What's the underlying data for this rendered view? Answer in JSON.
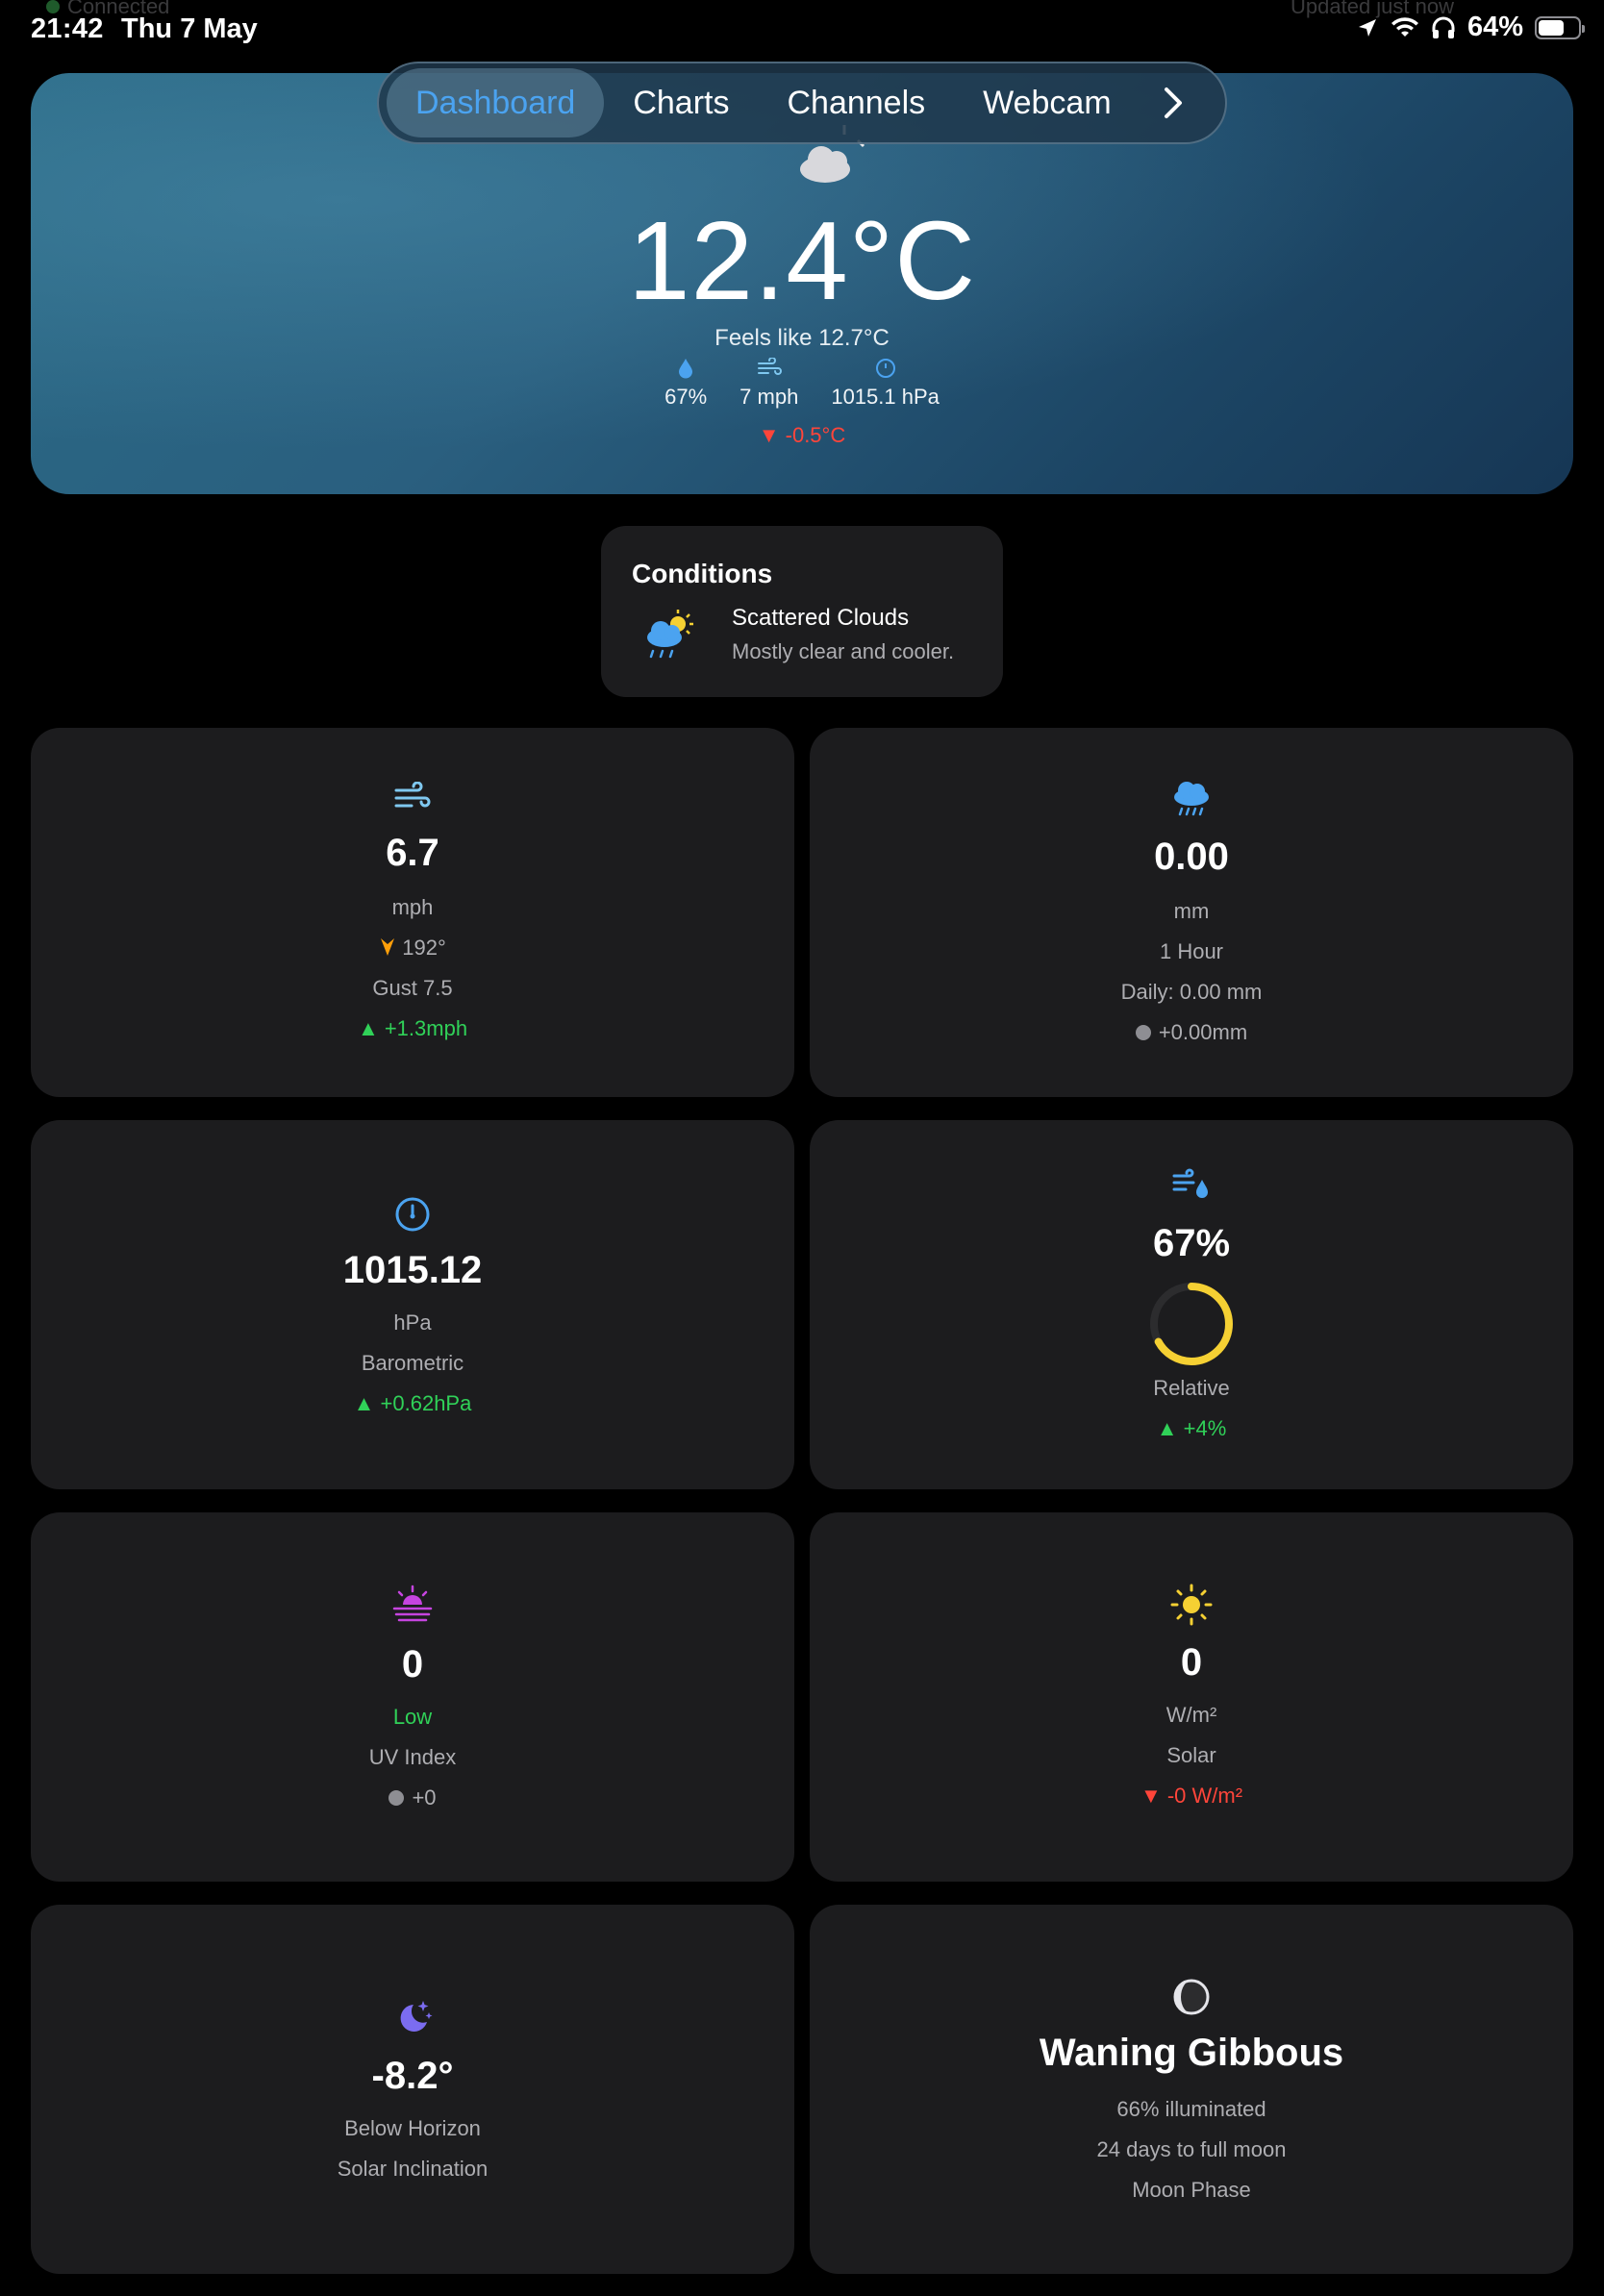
{
  "status_bar": {
    "time": "21:42",
    "date": "Thu 7 May",
    "connected": "Connected",
    "updated": "Updated just now",
    "battery": "64%",
    "battery_level": 0.64
  },
  "tabs": [
    {
      "label": "Dashboard",
      "active": true
    },
    {
      "label": "Charts",
      "active": false
    },
    {
      "label": "Channels",
      "active": false
    },
    {
      "label": "Webcam",
      "active": false
    }
  ],
  "hero": {
    "temperature": "12.4°C",
    "feels_like": "Feels like 12.7°C",
    "humidity": "67%",
    "wind": "7 mph",
    "pressure": "1015.1 hPa",
    "change": "▼ -0.5°C"
  },
  "conditions": {
    "title": "Conditions",
    "summary": "Scattered Clouds",
    "detail": "Mostly clear and cooler."
  },
  "cards": {
    "wind": {
      "value": "6.7",
      "unit": "mph",
      "direction": "192°",
      "gust": "Gust 7.5",
      "change": "▲ +1.3mph"
    },
    "rain": {
      "value": "0.00",
      "unit": "mm",
      "period": "1 Hour",
      "daily": "Daily: 0.00 mm",
      "change": "+0.00mm"
    },
    "pressure": {
      "value": "1015.12",
      "unit": "hPa",
      "label": "Barometric",
      "change": "▲ +0.62hPa"
    },
    "humidity": {
      "value": "67%",
      "level": 0.67,
      "label": "Relative",
      "change": "▲ +4%"
    },
    "uv": {
      "value": "0",
      "rating": "Low",
      "label": "UV Index",
      "change": "+0"
    },
    "solar": {
      "value": "0",
      "unit": "W/m²",
      "label": "Solar",
      "change": "▼ -0 W/m²"
    },
    "inclination": {
      "value": "-8.2°",
      "status": "Below Horizon",
      "label": "Solar Inclination"
    },
    "moon": {
      "phase": "Waning Gibbous",
      "illumination": "66% illuminated",
      "days_to_full": "24 days to full moon",
      "label": "Moon Phase"
    }
  },
  "colors": {
    "accent_blue": "#4ba3f0",
    "up_green": "#30d158",
    "down_red": "#ff453a",
    "uv_purple": "#c644e0",
    "sun_yellow": "#f5d033",
    "humidity_ring": "#f5d033",
    "wind_dir_orange": "#ff9f0a"
  }
}
